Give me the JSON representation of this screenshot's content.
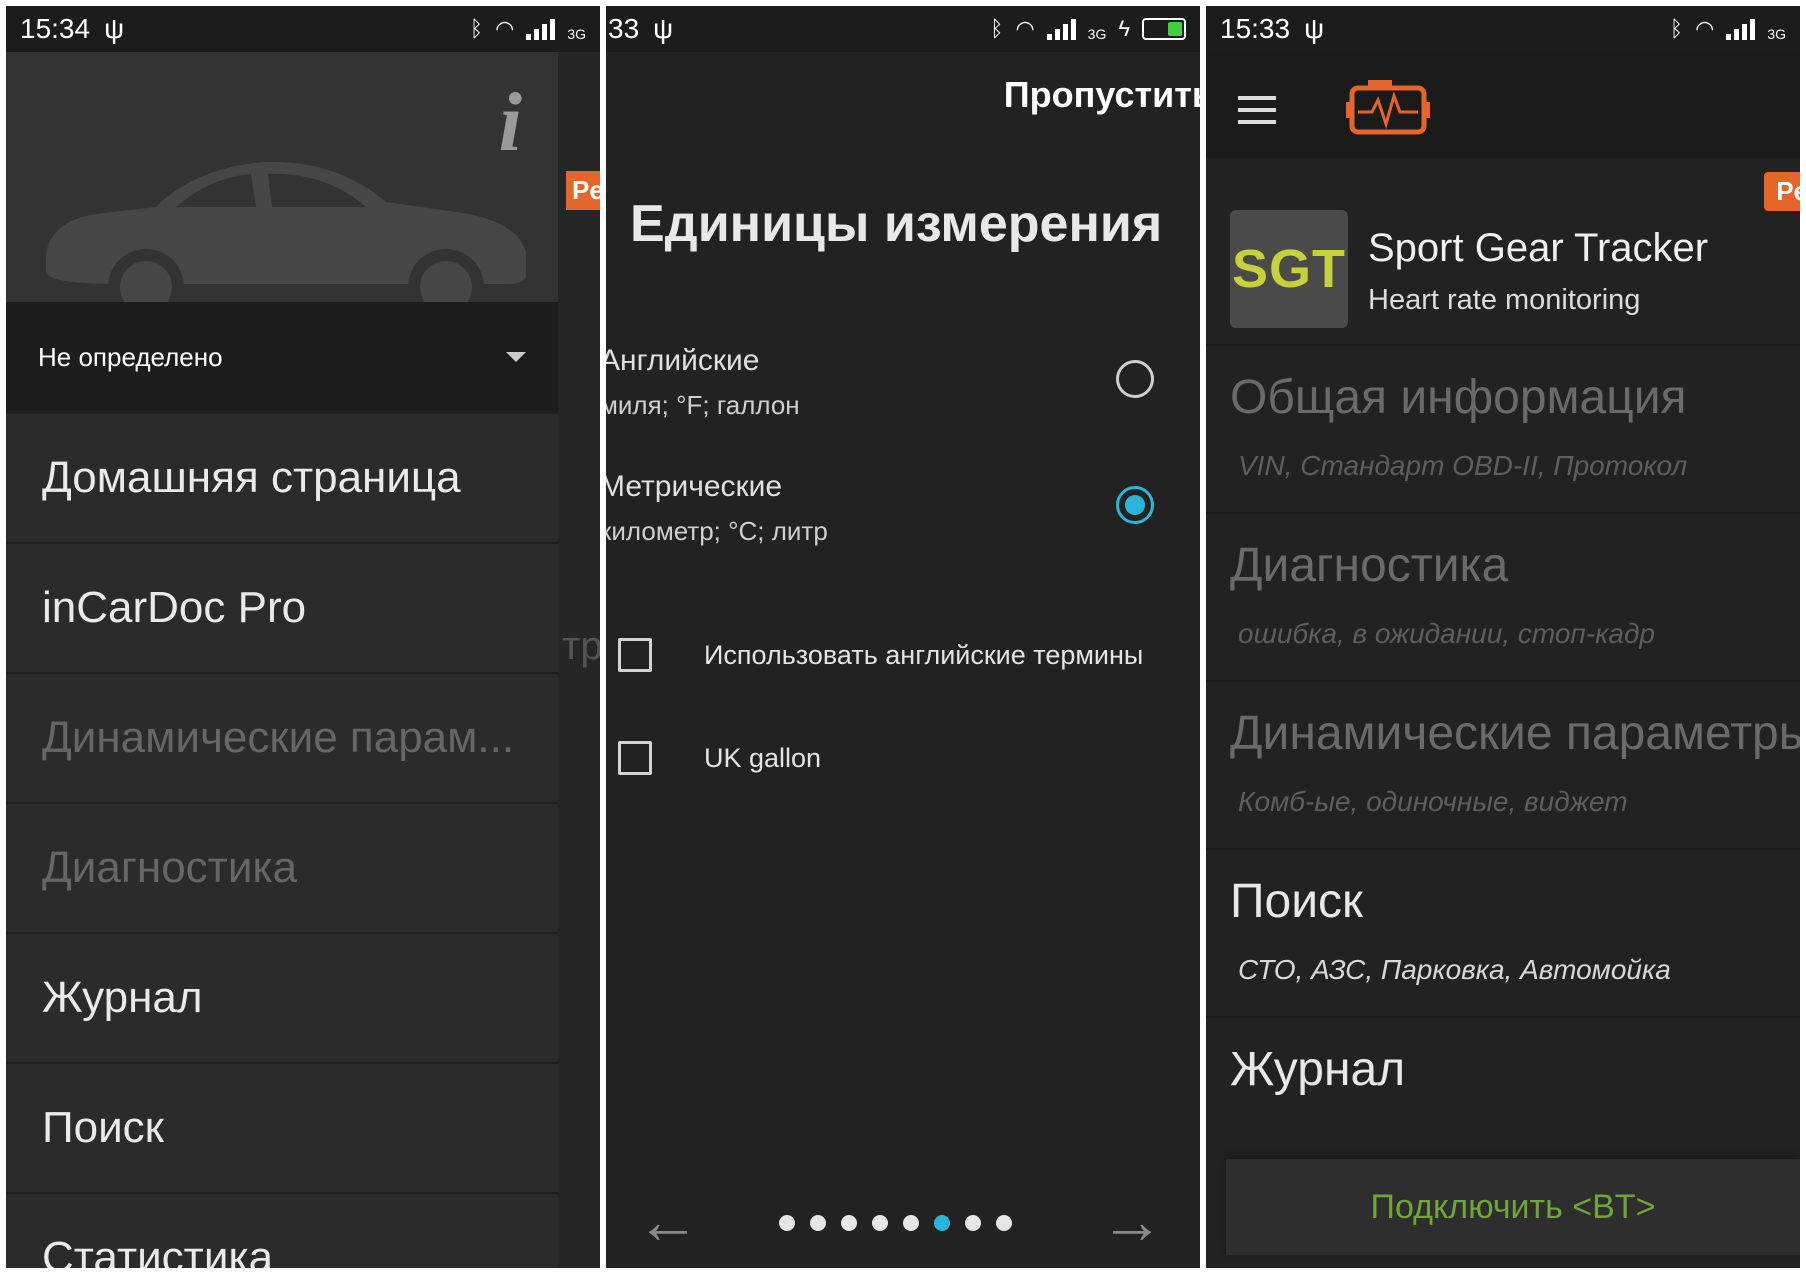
{
  "panel1": {
    "status": {
      "time": "15:34",
      "net": "3G"
    },
    "behind_tag": "Pe",
    "behind_text": "тр",
    "car_selector": "Не определено",
    "menu": [
      {
        "label": "Домашняя страница",
        "dim": false
      },
      {
        "label": "inCarDoc Pro",
        "dim": false
      },
      {
        "label": "Динамические парам...",
        "dim": true
      },
      {
        "label": "Диагностика",
        "dim": true
      },
      {
        "label": "Журнал",
        "dim": false
      },
      {
        "label": "Поиск",
        "dim": false
      },
      {
        "label": "Статистика",
        "dim": false
      }
    ]
  },
  "panel2": {
    "status": {
      "time": "33",
      "net": "3G"
    },
    "skip": "Пропустить",
    "title": "Единицы измерения",
    "units": [
      {
        "name": "Английские",
        "desc": "миля; °F; галлон",
        "selected": false
      },
      {
        "name": "Метрические",
        "desc": "километр; °C; литр",
        "selected": true
      }
    ],
    "checkboxes": [
      {
        "label": "Использовать английские термины",
        "checked": false
      },
      {
        "label": "UK gallon",
        "checked": false
      }
    ],
    "pager": {
      "count": 8,
      "active_index": 5
    },
    "back_arrow": "←",
    "forward_arrow": "→"
  },
  "panel3": {
    "status": {
      "time": "15:33",
      "net": "3G"
    },
    "badge": "Pe",
    "promo": {
      "logo": "SGT",
      "title": "Sport Gear Tracker",
      "subtitle": "Heart rate monitoring"
    },
    "sections": [
      {
        "title": "Общая информация",
        "subtitle": "VIN, Стандарт OBD-II, Протокол",
        "dim": true
      },
      {
        "title": "Диагностика",
        "subtitle": "ошибка, в ожидании, стоп-кадр",
        "dim": true
      },
      {
        "title": "Динамические параметры",
        "subtitle": "Комб-ые, одиночные, виджет",
        "dim": true
      },
      {
        "title": "Поиск",
        "subtitle": "СТО, АЗС, Парковка, Автомойка",
        "dim": false
      },
      {
        "title": "Журнал",
        "subtitle": "",
        "dim": false
      }
    ],
    "connect_button": "Подключить <BT>"
  },
  "colors": {
    "accent": "#29b6d8",
    "orange": "#e5652b",
    "connect_green": "#6fa53a",
    "background": "#222222"
  },
  "icons": [
    "usb-icon",
    "bluetooth-icon",
    "wifi-icon",
    "signal-icon",
    "battery-icon",
    "info-icon",
    "car-icon",
    "dropdown-icon",
    "menu-icon",
    "engine-logo-icon"
  ]
}
